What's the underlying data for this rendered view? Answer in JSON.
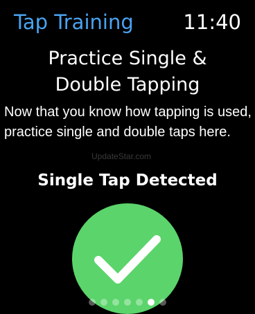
{
  "status_bar": {
    "title": "Tap Training",
    "time": "11:40"
  },
  "content": {
    "heading_line1": "Practice Single &",
    "heading_line2": "Double Tapping",
    "description": "Now that you know how tapping is used, practice single and double taps here.",
    "watermark": "UpdateStar.com",
    "status": "Single Tap Detected"
  },
  "indicator": {
    "icon": "checkmark-icon",
    "color": "#5bd46b"
  },
  "pagination": {
    "total": 7,
    "current": 6
  },
  "colors": {
    "background": "#000000",
    "accent": "#4aa3f0",
    "success": "#5bd46b"
  }
}
